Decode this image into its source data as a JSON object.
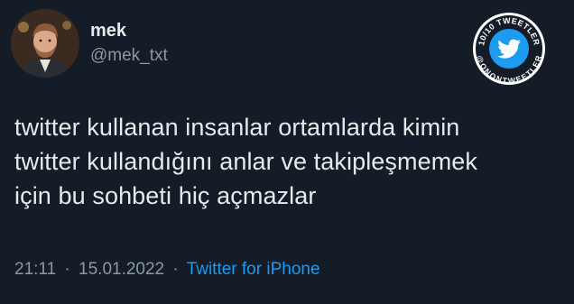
{
  "author": {
    "display_name": "mek",
    "handle": "@mek_txt",
    "avatar_icon": "user-avatar-photo"
  },
  "badge": {
    "text_top": "10/10 TWEETLER",
    "text_bottom": "@ONONTWEETLER",
    "icon": "twitter-bird-icon",
    "colors": {
      "ring": "#ffffff",
      "fill": "#1d9bf0",
      "bird": "#ffffff"
    }
  },
  "tweet": {
    "lines": [
      "twitter kullanan insanlar ortamlarda kimin",
      "twitter kullandığını anlar ve takipleşmemek",
      "için bu sohbeti hiç açmazlar"
    ]
  },
  "meta": {
    "time": "21:11",
    "date": "15.01.2022",
    "separator": "·",
    "source": "Twitter for iPhone"
  },
  "colors": {
    "background": "#141c27",
    "text_primary": "#e7e9ea",
    "text_secondary": "#8b98a5",
    "link": "#1d9bf0"
  }
}
